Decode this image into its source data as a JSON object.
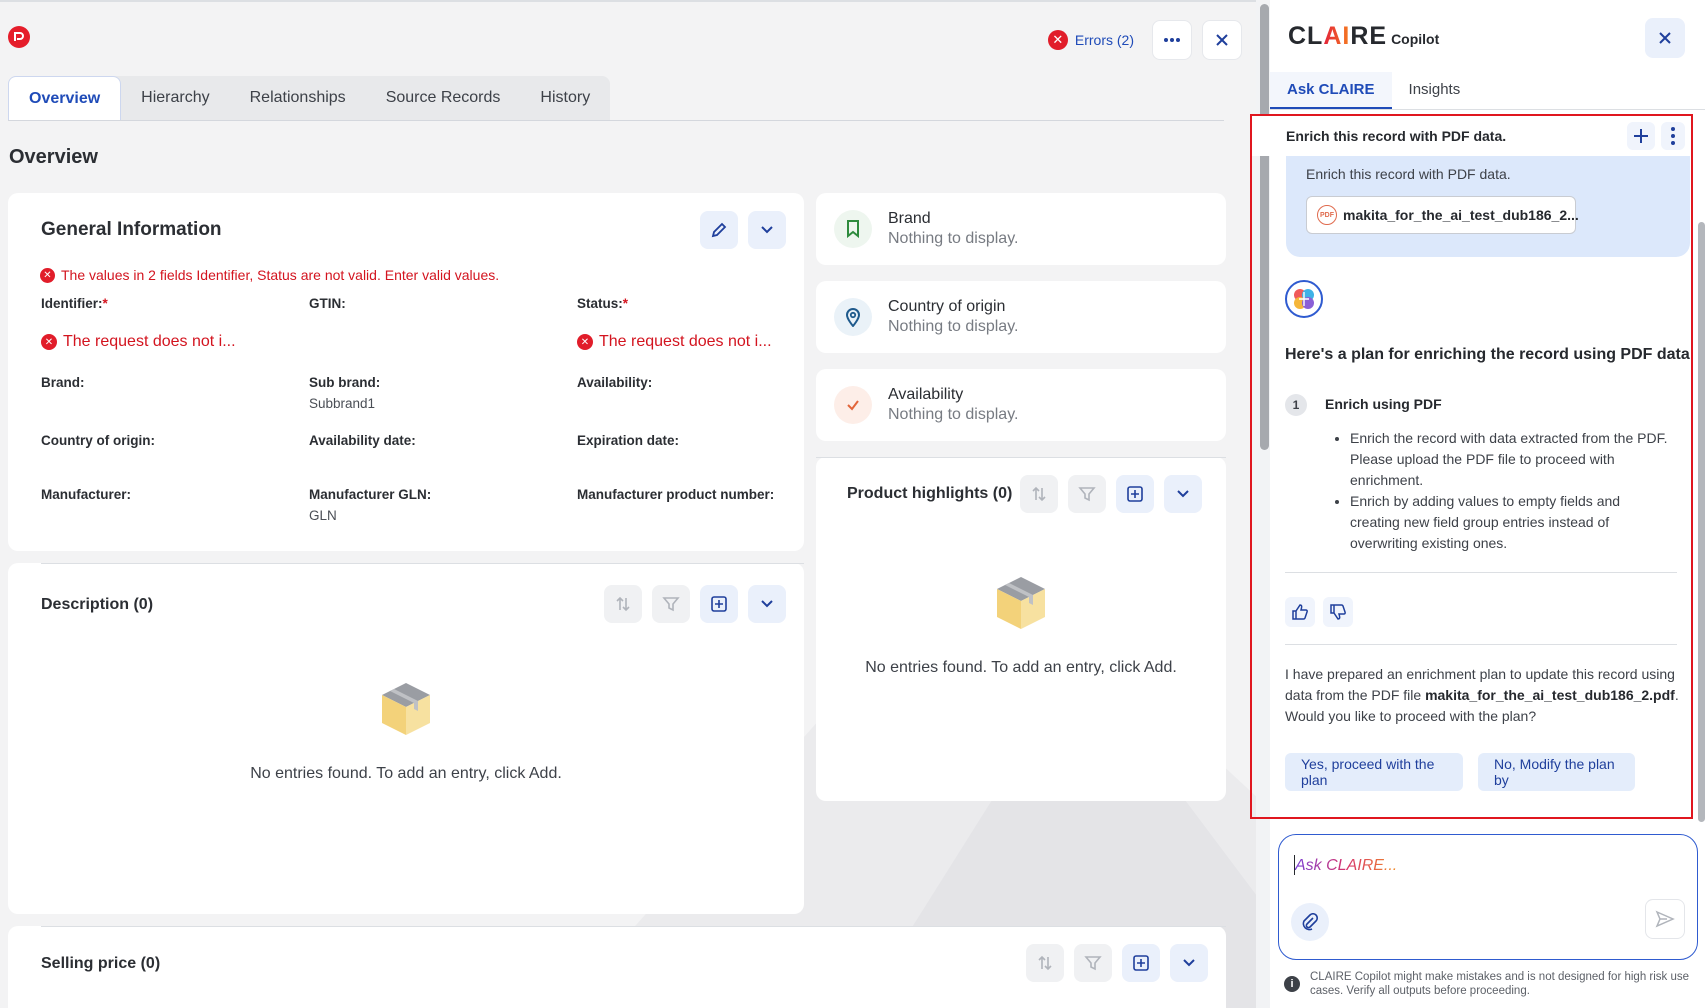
{
  "header": {
    "errors_label": "Errors (2)"
  },
  "tabs": [
    {
      "label": "Overview"
    },
    {
      "label": "Hierarchy"
    },
    {
      "label": "Relationships"
    },
    {
      "label": "Source Records"
    },
    {
      "label": "History"
    }
  ],
  "page_title": "Overview",
  "general_info": {
    "title": "General Information",
    "error_message": "The values in 2 fields Identifier, Status are not valid. Enter valid values.",
    "fields": {
      "identifier": {
        "label": "Identifier:",
        "required": "*",
        "error": "The request does not i..."
      },
      "gtin": {
        "label": "GTIN:"
      },
      "status": {
        "label": "Status:",
        "required": "*",
        "error": "The request does not i..."
      },
      "brand": {
        "label": "Brand:"
      },
      "sub_brand": {
        "label": "Sub brand:",
        "value": "Subbrand1"
      },
      "availability": {
        "label": "Availability:"
      },
      "country_of_origin": {
        "label": "Country of origin:"
      },
      "availability_date": {
        "label": "Availability date:"
      },
      "expiration_date": {
        "label": "Expiration date:"
      },
      "manufacturer": {
        "label": "Manufacturer:"
      },
      "manufacturer_gln": {
        "label": "Manufacturer GLN:",
        "value": "GLN"
      },
      "manufacturer_product_number": {
        "label": "Manufacturer product number:"
      }
    }
  },
  "side_cards": [
    {
      "title": "Brand",
      "subtitle": "Nothing to display.",
      "icon": "bookmark-icon"
    },
    {
      "title": "Country of origin",
      "subtitle": "Nothing to display.",
      "icon": "location-pin-icon"
    },
    {
      "title": "Availability",
      "subtitle": "Nothing to display.",
      "icon": "checkmark-icon"
    }
  ],
  "description": {
    "title": "Description (0)",
    "empty": "No entries found. To add an entry, click Add."
  },
  "product_highlights": {
    "title": "Product highlights (0)",
    "empty": "No entries found. To add an entry, click Add."
  },
  "selling_price": {
    "title": "Selling price (0)"
  },
  "copilot": {
    "brand_claire_prefix": "CL",
    "brand_claire_ai": "AI",
    "brand_claire_suffix": "RE",
    "brand_copilot": "Copilot",
    "tabs": [
      {
        "label": "Ask CLAIRE"
      },
      {
        "label": "Insights"
      }
    ],
    "conversation_title": "Enrich this record with PDF data.",
    "user_message": "Enrich this record with PDF data.",
    "attachment_name": "makita_for_the_ai_test_dub186_2...",
    "attachment_type": "PDF",
    "plan_title": "Here's a plan for enriching the record using PDF data",
    "step": {
      "number": "1",
      "title": "Enrich using PDF",
      "bullets": [
        "Enrich the record with data extracted from the PDF. Please upload the PDF file to proceed with enrichment.",
        "Enrich by adding values to empty fields and creating new field group entries instead of overwriting existing ones."
      ]
    },
    "reply_prefix": "I have prepared an enrichment plan to update this record using data from the PDF file ",
    "reply_file": "makita_for_the_ai_test_dub186_2.pdf",
    "reply_suffix": ". Would you like to proceed with the plan?",
    "actions": [
      {
        "label": "Yes, proceed with the plan"
      },
      {
        "label": "No, Modify the plan by"
      }
    ],
    "input_placeholder": "Ask CLAIRE...",
    "disclaimer": "CLAIRE Copilot might make mistakes and is not designed for high risk use cases. Verify all outputs before proceeding."
  },
  "colors": {
    "accent": "#1f4bb8",
    "error": "#d3141f",
    "highlight_frame": "#e0161f",
    "user_bubble": "#dce8fb"
  }
}
